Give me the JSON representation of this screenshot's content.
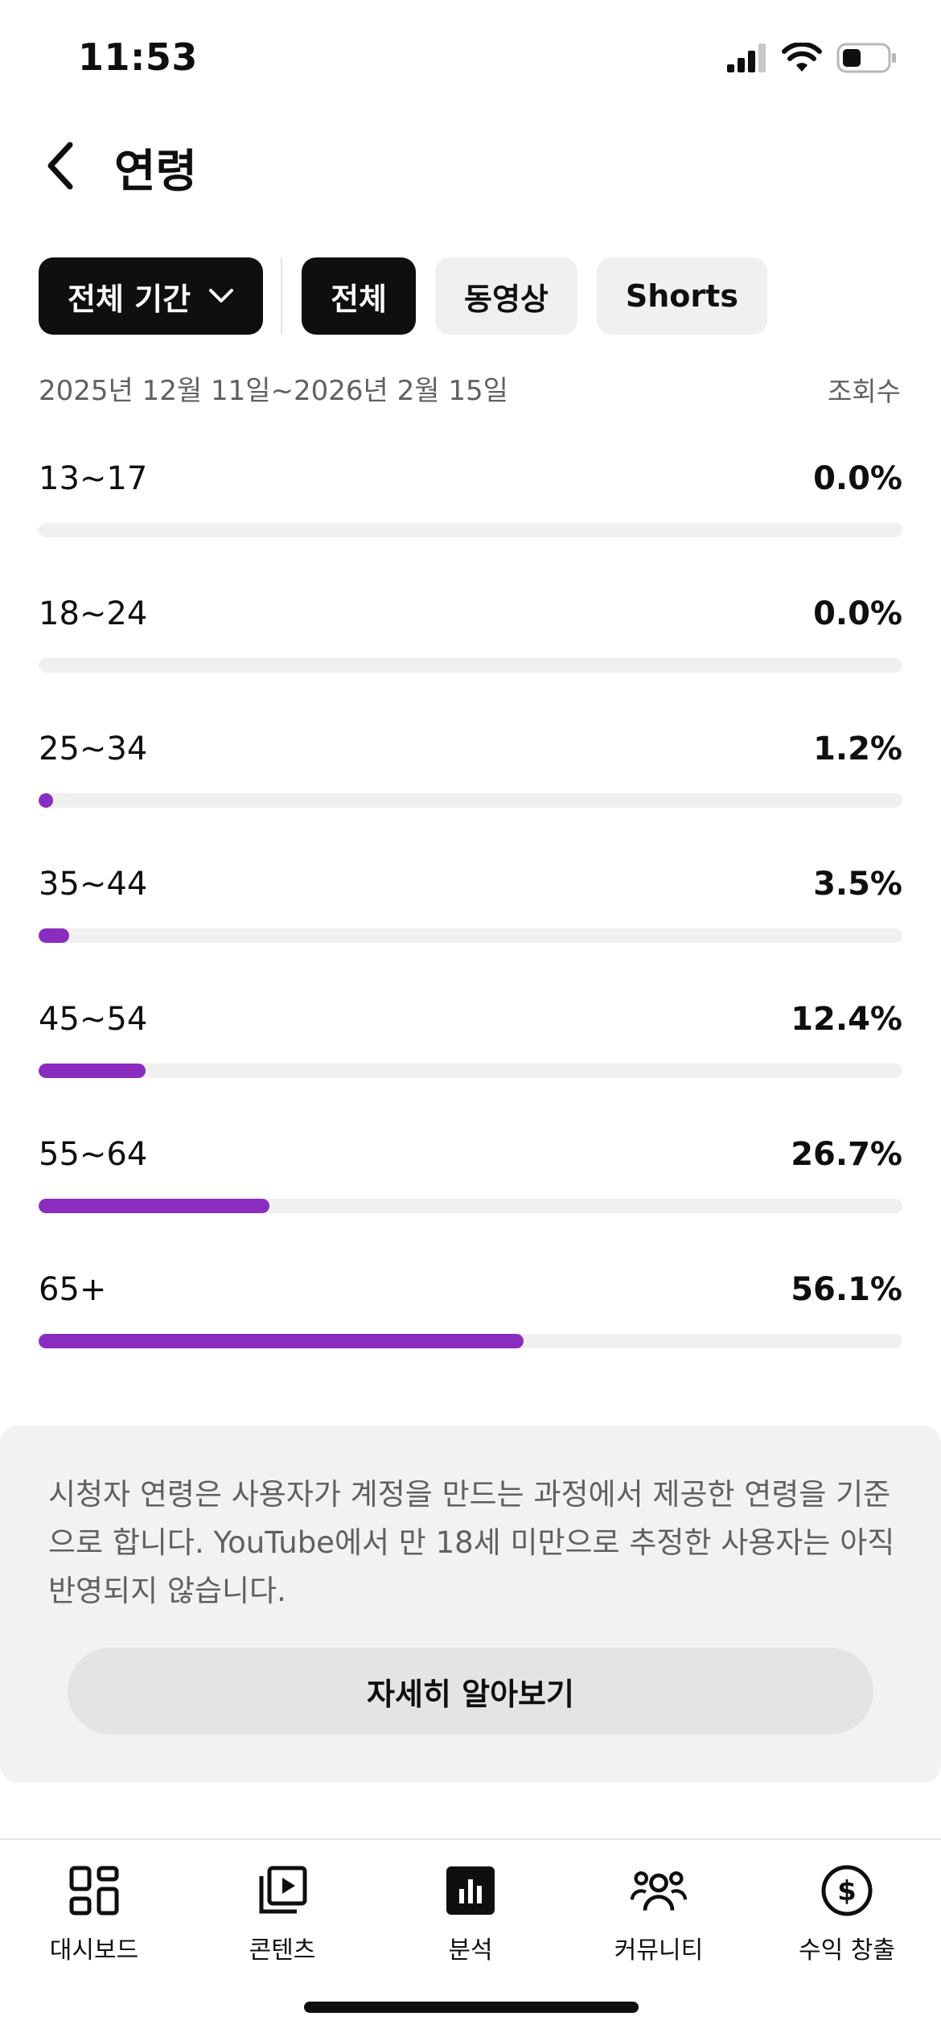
{
  "status_bar": {
    "time": "11:53"
  },
  "header": {
    "title": "연령"
  },
  "filters": {
    "period": "전체 기간",
    "chips": [
      "전체",
      "동영상",
      "Shorts"
    ],
    "selected": "전체"
  },
  "summary": {
    "date_range": "2025년 12월 11일~2026년 2월 15일",
    "metric": "조회수"
  },
  "age_groups": [
    {
      "label": "13~17",
      "value": "0.0%",
      "percent": 0.0
    },
    {
      "label": "18~24",
      "value": "0.0%",
      "percent": 0.0
    },
    {
      "label": "25~34",
      "value": "1.2%",
      "percent": 1.2
    },
    {
      "label": "35~44",
      "value": "3.5%",
      "percent": 3.5
    },
    {
      "label": "45~54",
      "value": "12.4%",
      "percent": 12.4
    },
    {
      "label": "55~64",
      "value": "26.7%",
      "percent": 26.7
    },
    {
      "label": "65+",
      "value": "56.1%",
      "percent": 56.1
    }
  ],
  "bar_color": "#8a2dbf",
  "info": {
    "text": "시청자 연령은 사용자가 계정을 만드는 과정에서 제공한 연령을 기준으로 합니다. YouTube에서 만 18세 미만으로 추정한 사용자는 아직 반영되지 않습니다.",
    "button": "자세히 알아보기"
  },
  "nav": [
    {
      "label": "대시보드",
      "icon": "dashboard-icon"
    },
    {
      "label": "콘텐츠",
      "icon": "content-icon"
    },
    {
      "label": "분석",
      "icon": "analytics-icon"
    },
    {
      "label": "커뮤니티",
      "icon": "community-icon"
    },
    {
      "label": "수익 창출",
      "icon": "monetization-icon"
    }
  ]
}
